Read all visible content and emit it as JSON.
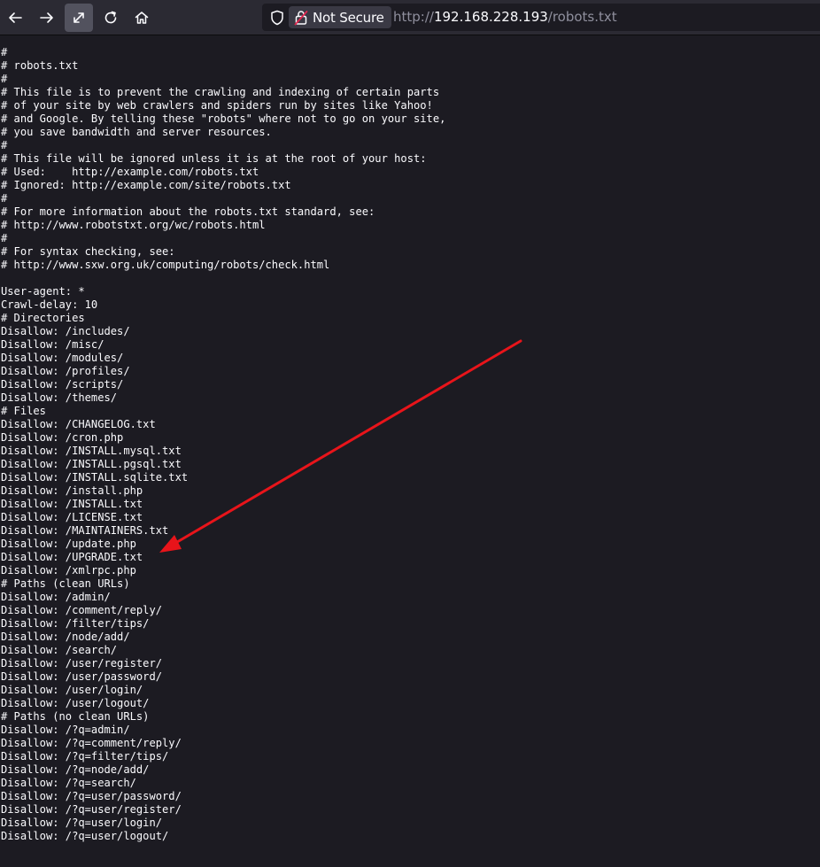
{
  "browser": {
    "nav": {
      "back_icon": "arrow-left-icon",
      "forward_icon": "arrow-right-icon",
      "fullscreen_icon": "expand-diagonal-icon",
      "reload_icon": "reload-icon",
      "home_icon": "home-icon"
    },
    "urlbar": {
      "tracking_icon": "shield-icon",
      "security_icon": "insecure-lock-icon",
      "security_label": "Not Secure",
      "url_scheme": "http://",
      "url_host": "192.168.228.193",
      "url_path": "/robots.txt"
    }
  },
  "annotation": {
    "arrow_color": "#e8141a",
    "arrow_icon": "red-arrow-annotation"
  },
  "document": {
    "lines": [
      "#",
      "# robots.txt",
      "#",
      "# This file is to prevent the crawling and indexing of certain parts",
      "# of your site by web crawlers and spiders run by sites like Yahoo!",
      "# and Google. By telling these \"robots\" where not to go on your site,",
      "# you save bandwidth and server resources.",
      "#",
      "# This file will be ignored unless it is at the root of your host:",
      "# Used:    http://example.com/robots.txt",
      "# Ignored: http://example.com/site/robots.txt",
      "#",
      "# For more information about the robots.txt standard, see:",
      "# http://www.robotstxt.org/wc/robots.html",
      "#",
      "# For syntax checking, see:",
      "# http://www.sxw.org.uk/computing/robots/check.html",
      "",
      "User-agent: *",
      "Crawl-delay: 10",
      "# Directories",
      "Disallow: /includes/",
      "Disallow: /misc/",
      "Disallow: /modules/",
      "Disallow: /profiles/",
      "Disallow: /scripts/",
      "Disallow: /themes/",
      "# Files",
      "Disallow: /CHANGELOG.txt",
      "Disallow: /cron.php",
      "Disallow: /INSTALL.mysql.txt",
      "Disallow: /INSTALL.pgsql.txt",
      "Disallow: /INSTALL.sqlite.txt",
      "Disallow: /install.php",
      "Disallow: /INSTALL.txt",
      "Disallow: /LICENSE.txt",
      "Disallow: /MAINTAINERS.txt",
      "Disallow: /update.php",
      "Disallow: /UPGRADE.txt",
      "Disallow: /xmlrpc.php",
      "# Paths (clean URLs)",
      "Disallow: /admin/",
      "Disallow: /comment/reply/",
      "Disallow: /filter/tips/",
      "Disallow: /node/add/",
      "Disallow: /search/",
      "Disallow: /user/register/",
      "Disallow: /user/password/",
      "Disallow: /user/login/",
      "Disallow: /user/logout/",
      "# Paths (no clean URLs)",
      "Disallow: /?q=admin/",
      "Disallow: /?q=comment/reply/",
      "Disallow: /?q=filter/tips/",
      "Disallow: /?q=node/add/",
      "Disallow: /?q=search/",
      "Disallow: /?q=user/password/",
      "Disallow: /?q=user/register/",
      "Disallow: /?q=user/login/",
      "Disallow: /?q=user/logout/"
    ]
  }
}
